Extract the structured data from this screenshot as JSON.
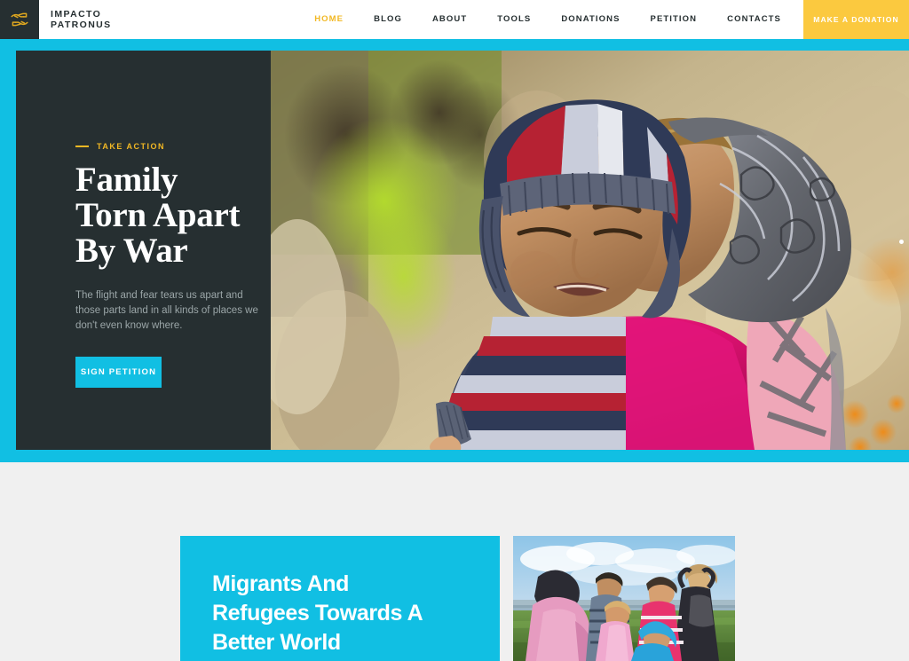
{
  "header": {
    "logo": {
      "icon": "hands-giving-icon",
      "line1": "IMPACTO",
      "line2": "PATRONUS"
    },
    "nav": [
      {
        "label": "HOME",
        "active": true
      },
      {
        "label": "BLOG",
        "active": false
      },
      {
        "label": "ABOUT",
        "active": false
      },
      {
        "label": "TOOLS",
        "active": false
      },
      {
        "label": "DONATIONS",
        "active": false
      },
      {
        "label": "PETITION",
        "active": false
      },
      {
        "label": "CONTACTS",
        "active": false
      }
    ],
    "donate_label": "MAKE A DONATION"
  },
  "hero": {
    "eyebrow": "TAKE ACTION",
    "title_line1": "Family",
    "title_line2": "Torn Apart",
    "title_line3": "By War",
    "description": "The flight and fear tears us apart and those parts land in all kinds of places we don't even know where.",
    "cta_label": "SIGN PETITION",
    "image_alt": "mother-holding-baby-photo",
    "carousel_dot": "carousel-dot-active"
  },
  "lower": {
    "card_title_line1": "Migrants And",
    "card_title_line2": "Refugees Towards A",
    "card_title_line3": "Better World",
    "image_alt": "refugee-children-field-photo"
  },
  "colors": {
    "accent_blue": "#11bfe3",
    "accent_yellow": "#fbc93f",
    "eyebrow_yellow": "#f2b824",
    "dark": "#262f31",
    "page_bg": "#f0f0f0",
    "muted_text": "#9ba6a8"
  }
}
